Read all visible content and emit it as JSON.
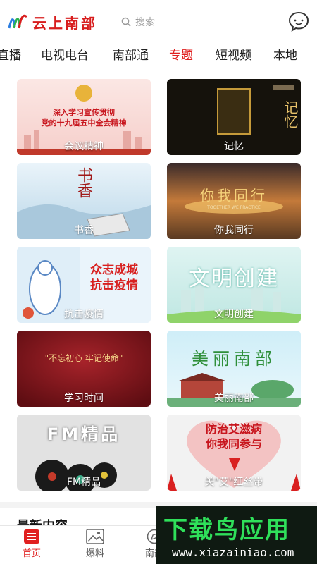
{
  "header": {
    "logo_text": "云上南部",
    "search_placeholder": "搜索",
    "message_icon": "chat-bubble-icon",
    "brand_color": "#d81e1e"
  },
  "tabs": [
    {
      "label": "直播",
      "active": false
    },
    {
      "label": "电视电台",
      "active": false
    },
    {
      "label": "南部通",
      "active": false
    },
    {
      "label": "专题",
      "active": true
    },
    {
      "label": "短视频",
      "active": false
    },
    {
      "label": "本地",
      "active": false
    }
  ],
  "topics": [
    {
      "caption": "会议精神",
      "headline": "深入学习宣传贯彻\n党的十九届五中全会精神"
    },
    {
      "caption": "记忆",
      "headline": "记忆"
    },
    {
      "caption": "书香",
      "headline": "书香"
    },
    {
      "caption": "你我同行",
      "headline": "你我同行",
      "sub": "TOGETHER WE PRACTICE"
    },
    {
      "caption": "抗击疫情",
      "headline": "众志成城\n抗击疫情"
    },
    {
      "caption": "文明创建",
      "headline": "文明创建"
    },
    {
      "caption": "学习时间",
      "headline": "\"不忘初心 牢记使命\""
    },
    {
      "caption": "美丽南部",
      "headline": "美丽南部"
    },
    {
      "caption": "FM精品",
      "headline": "FM精品"
    },
    {
      "caption": "关\"艾\"红丝带",
      "headline": "防治艾滋病\n你我同参与"
    }
  ],
  "latest": {
    "title": "最新内容"
  },
  "bottom_nav": [
    {
      "label": "首页",
      "icon": "home-list-icon",
      "active": true
    },
    {
      "label": "爆料",
      "icon": "image-icon",
      "active": false
    },
    {
      "label": "南部",
      "icon": "compass-icon",
      "active": false
    }
  ],
  "watermark": {
    "title": "下载鸟应用",
    "url": "www.xiazainiao.com"
  },
  "accent": "#e02020"
}
